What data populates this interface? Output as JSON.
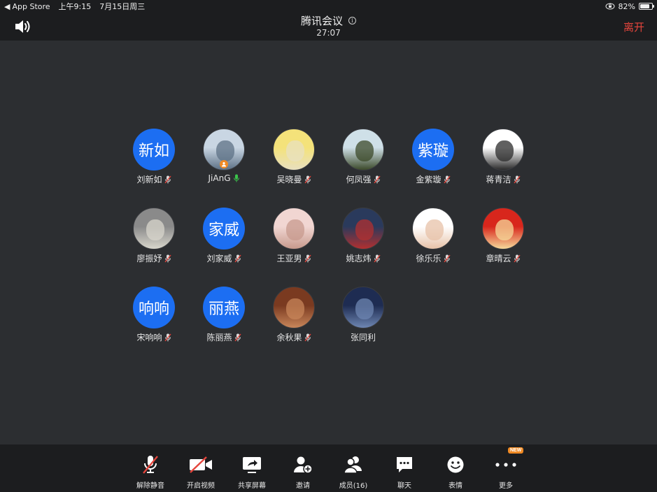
{
  "status_bar": {
    "back_app": "App Store",
    "time": "上午9:15",
    "date": "7月15日周三",
    "battery": "82%",
    "battery_level": 0.82
  },
  "header": {
    "title": "腾讯会议",
    "timer": "27:07",
    "leave_label": "离开"
  },
  "participants": [
    {
      "name": "刘新如",
      "avatar_text": "新如",
      "avatar_type": "initials",
      "mic": "muted"
    },
    {
      "name": "JiAnG",
      "avatar_text": "",
      "avatar_type": "photo",
      "photo_colors": [
        "#c9d6e3",
        "#5d7186"
      ],
      "mic": "active",
      "host": true
    },
    {
      "name": "吴晓曼",
      "avatar_text": "",
      "avatar_type": "photo",
      "photo_colors": [
        "#f4e27a",
        "#e8e0c0"
      ],
      "mic": "muted"
    },
    {
      "name": "何凤强",
      "avatar_text": "",
      "avatar_type": "photo",
      "photo_colors": [
        "#cfe0e8",
        "#3c4a2a"
      ],
      "mic": "muted"
    },
    {
      "name": "金紫璇",
      "avatar_text": "紫璇",
      "avatar_type": "initials",
      "mic": "muted"
    },
    {
      "name": "蒋青洁",
      "avatar_text": "",
      "avatar_type": "photo",
      "photo_colors": [
        "#ffffff",
        "#2b2b2b"
      ],
      "mic": "muted"
    },
    {
      "name": "廖振妤",
      "avatar_text": "",
      "avatar_type": "photo",
      "photo_colors": [
        "#8a8a8a",
        "#d8d6cc"
      ],
      "mic": "muted"
    },
    {
      "name": "刘家威",
      "avatar_text": "家威",
      "avatar_type": "initials",
      "mic": "muted"
    },
    {
      "name": "王亚男",
      "avatar_text": "",
      "avatar_type": "photo",
      "photo_colors": [
        "#f1d6d2",
        "#c79a8d"
      ],
      "mic": "muted"
    },
    {
      "name": "姚志炜",
      "avatar_text": "",
      "avatar_type": "photo",
      "photo_colors": [
        "#2a3a5c",
        "#b23030"
      ],
      "mic": "muted"
    },
    {
      "name": "徐乐乐",
      "avatar_text": "",
      "avatar_type": "photo",
      "photo_colors": [
        "#ffffff",
        "#e7c2a8"
      ],
      "mic": "muted"
    },
    {
      "name": "章晴云",
      "avatar_text": "",
      "avatar_type": "photo",
      "photo_colors": [
        "#d8261c",
        "#f5d89a"
      ],
      "mic": "muted"
    },
    {
      "name": "宋响响",
      "avatar_text": "响响",
      "avatar_type": "initials",
      "mic": "muted"
    },
    {
      "name": "陈丽燕",
      "avatar_text": "丽燕",
      "avatar_type": "initials",
      "mic": "muted"
    },
    {
      "name": "余秋果",
      "avatar_text": "",
      "avatar_type": "photo",
      "photo_colors": [
        "#7a3a20",
        "#c8865a"
      ],
      "mic": "muted"
    },
    {
      "name": "张同利",
      "avatar_text": "",
      "avatar_type": "photo",
      "photo_colors": [
        "#1e2c52",
        "#6e86b2"
      ],
      "mic": "none"
    }
  ],
  "toolbar": [
    {
      "label": "解除静音",
      "icon": "mic-muted-icon"
    },
    {
      "label": "开启视频",
      "icon": "video-off-icon"
    },
    {
      "label": "共享屏幕",
      "icon": "share-screen-icon"
    },
    {
      "label": "邀请",
      "icon": "invite-user-icon"
    },
    {
      "label": "成员(16)",
      "icon": "members-icon"
    },
    {
      "label": "聊天",
      "icon": "chat-icon"
    },
    {
      "label": "表情",
      "icon": "emoji-icon"
    },
    {
      "label": "更多",
      "icon": "more-icon",
      "badge": "NEW"
    }
  ],
  "colors": {
    "background": "#2c2e31",
    "bar": "#1c1d1f",
    "accent_blue": "#1c6ef2",
    "leave_red": "#e5453c",
    "mic_muted": "#e5453c",
    "mic_active": "#3bc44b",
    "badge_orange": "#f08a24"
  }
}
